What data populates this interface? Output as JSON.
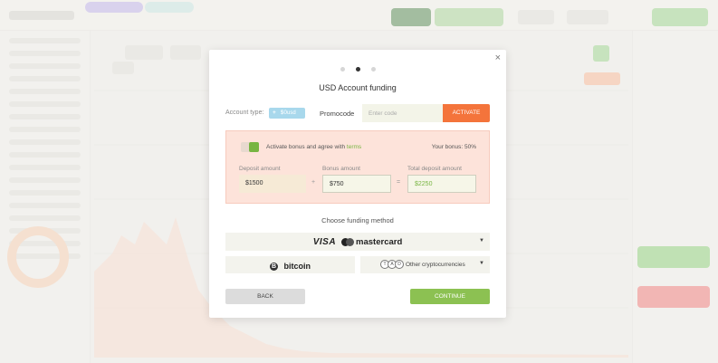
{
  "modal": {
    "title": "USD Account funding",
    "close_glyph": "×",
    "steps": {
      "count": 3,
      "current": 2
    },
    "account": {
      "label": "Account type:",
      "badge_plus": "+",
      "badge_value": "$0",
      "badge_unit": "usd"
    },
    "promocode": {
      "label": "Promocode",
      "placeholder": "Enter code",
      "value": "",
      "activate_label": "ACTIVATE"
    },
    "bonus": {
      "agree_text": "Activate bonus and agree with",
      "terms_link": "terms",
      "your_bonus": "Your bonus: 50%",
      "checked": true,
      "deposit_label": "Deposit amount",
      "deposit_value": "$1500",
      "bonus_label": "Bonus amount",
      "bonus_value": "$750",
      "total_label": "Total deposit amount",
      "total_value": "$2250",
      "plus_sign": "+",
      "equals_sign": "="
    },
    "funding": {
      "heading": "Choose funding method",
      "card": {
        "visa": "VISA",
        "mastercard": "mastercard",
        "icon": "mastercard-icon",
        "caret_icon": "chevron-down-icon"
      },
      "bitcoin": {
        "symbol": "B",
        "label": "bitcoin",
        "icon": "bitcoin-icon"
      },
      "crypto": {
        "label": "Other cryptocurrencies",
        "icon_letters": [
          "T",
          "A",
          "D"
        ],
        "caret_icon": "chevron-down-icon"
      }
    },
    "buttons": {
      "back": "BACK",
      "continue": "CONTINUE"
    }
  },
  "colors": {
    "accent_orange": "#f4743b",
    "accent_green": "#8cc152",
    "bonus_panel": "#fde3da"
  }
}
